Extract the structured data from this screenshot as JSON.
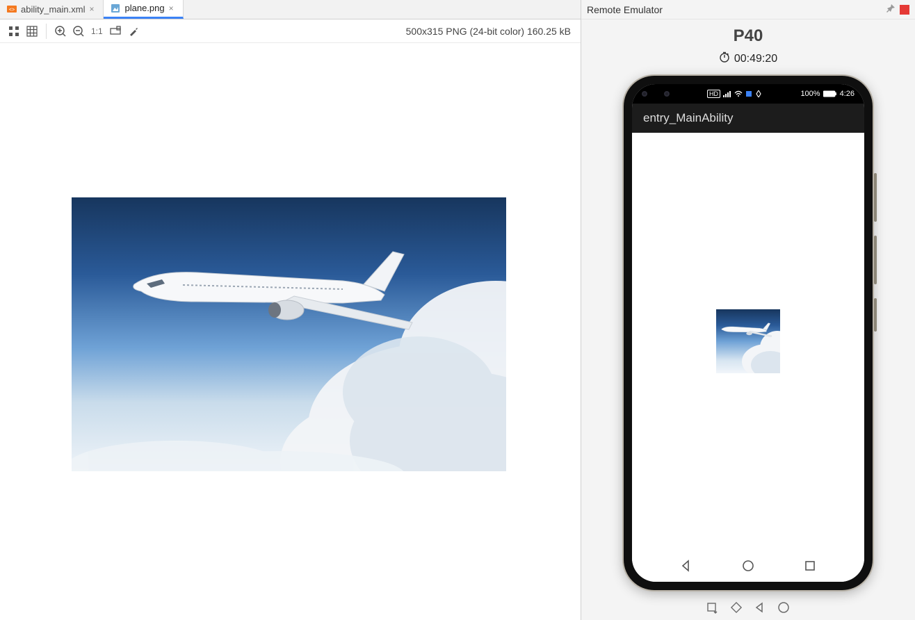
{
  "tabs": [
    {
      "label": "ability_main.xml",
      "active": false
    },
    {
      "label": "plane.png",
      "active": true
    }
  ],
  "image_status": "500x315 PNG (24-bit color) 160.25 kB",
  "emulator": {
    "title": "Remote Emulator",
    "device": "P40",
    "timer": "00:49:20",
    "status_bar": {
      "battery_text": "100%",
      "clock": "4:26"
    },
    "app_title": "entry_MainAbility"
  },
  "toolbar_labels": {
    "one_to_one": "1:1"
  }
}
